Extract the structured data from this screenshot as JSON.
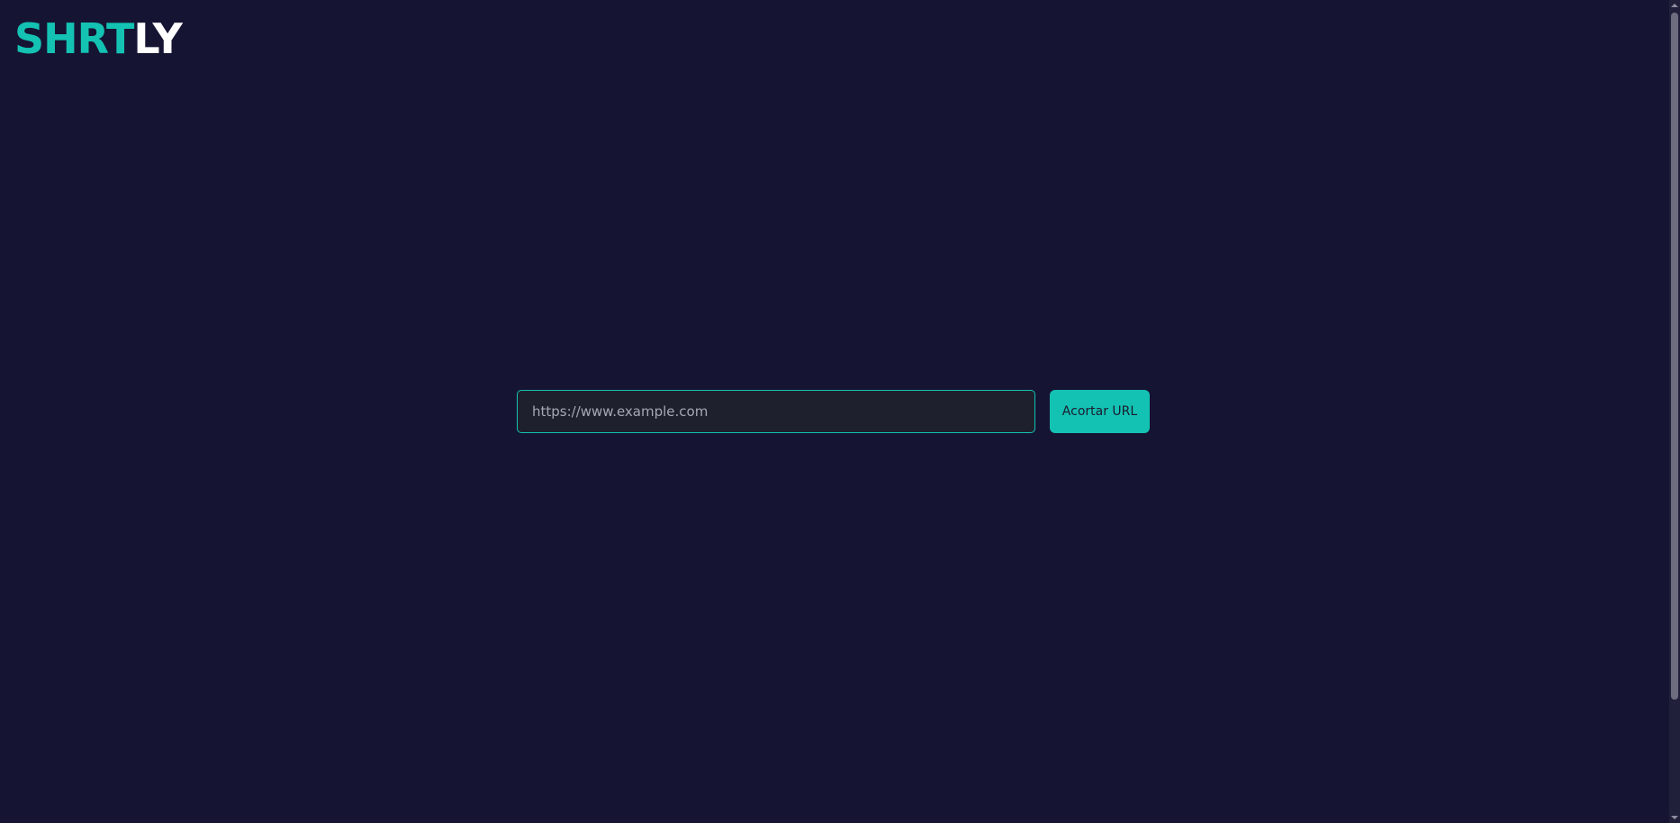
{
  "header": {
    "logo_accent": "SHRT",
    "logo_rest": "LY"
  },
  "form": {
    "url_placeholder": "https://www.example.com",
    "url_value": "",
    "submit_label": "Acortar URL"
  },
  "colors": {
    "background": "#161433",
    "accent": "#14c2b3",
    "input_background": "#1e212d",
    "logo_secondary": "#ffffff"
  },
  "icons": {
    "scroll_up": "chevron-up-icon",
    "scroll_down": "chevron-down-icon"
  }
}
